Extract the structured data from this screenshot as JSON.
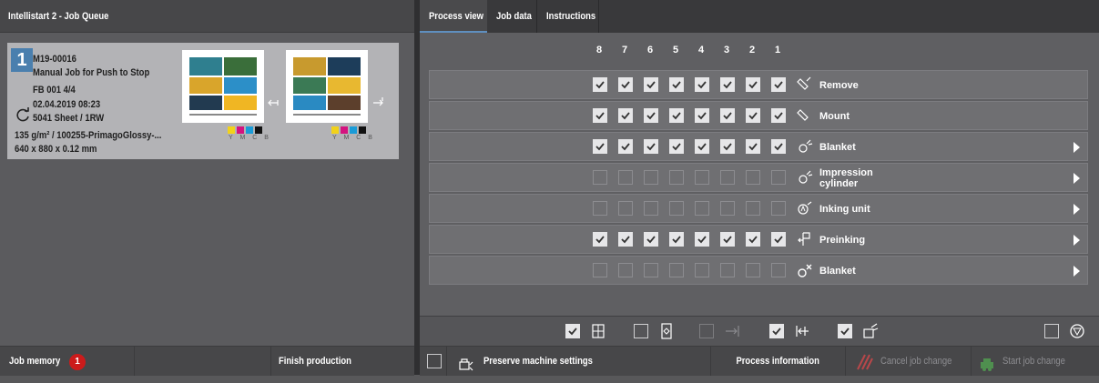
{
  "left_panel": {
    "title": "Intellistart 2 - Job Queue",
    "job": {
      "number": "1",
      "id": "M19-00016",
      "name": "Manual Job for Push to Stop",
      "form": "FB 001  4/4",
      "date": "02.04.2019 08:23",
      "sheets": "5041 Sheet / 1RW",
      "paper": "135 g/m² / 100255-PrimagoGlossy-...",
      "format": "640 x 880 x 0.12 mm",
      "ink_labels": "Y M C B",
      "ink_colors": [
        "#f2d21a",
        "#d4137f",
        "#1a9bd7",
        "#111111"
      ]
    },
    "bottom": {
      "job_memory": "Job memory",
      "job_memory_count": "1",
      "finish_production": "Finish production"
    }
  },
  "right_panel": {
    "tabs": [
      {
        "label": "Process view",
        "active": true
      },
      {
        "label": "Job data",
        "active": false
      },
      {
        "label": "Instructions",
        "active": false
      }
    ],
    "units": [
      "8",
      "7",
      "6",
      "5",
      "4",
      "3",
      "2",
      "1"
    ],
    "rows": [
      {
        "label": "Remove",
        "checked": [
          true,
          true,
          true,
          true,
          true,
          true,
          true,
          true
        ],
        "icon": "plate-remove-icon",
        "has_arrow": false
      },
      {
        "label": "Mount",
        "checked": [
          true,
          true,
          true,
          true,
          true,
          true,
          true,
          true
        ],
        "icon": "plate-mount-icon",
        "has_arrow": false
      },
      {
        "label": "Blanket",
        "checked": [
          true,
          true,
          true,
          true,
          true,
          true,
          true,
          true
        ],
        "icon": "blanket-wash-icon",
        "has_arrow": true
      },
      {
        "label": "Impression cylinder",
        "checked": [
          false,
          false,
          false,
          false,
          false,
          false,
          false,
          false
        ],
        "icon": "impression-cylinder-icon",
        "has_arrow": true
      },
      {
        "label": "Inking unit",
        "checked": [
          false,
          false,
          false,
          false,
          false,
          false,
          false,
          false
        ],
        "icon": "inking-unit-icon",
        "has_arrow": true
      },
      {
        "label": "Preinking",
        "checked": [
          true,
          true,
          true,
          true,
          true,
          true,
          true,
          true
        ],
        "icon": "preinking-icon",
        "has_arrow": true
      },
      {
        "label": "Blanket",
        "checked": [
          false,
          false,
          false,
          false,
          false,
          false,
          false,
          false
        ],
        "icon": "blanket-change-icon",
        "has_arrow": true
      }
    ],
    "icon_bar": [
      {
        "checked": true,
        "icon": "register-icon",
        "enabled": true
      },
      {
        "checked": false,
        "icon": "format-icon",
        "enabled": true
      },
      {
        "checked": false,
        "icon": "feeder-icon",
        "enabled": false
      },
      {
        "checked": true,
        "icon": "delivery-icon",
        "enabled": true
      },
      {
        "checked": true,
        "icon": "ink-preset-icon",
        "enabled": true
      },
      {
        "checked": false,
        "icon": "stop-icon",
        "enabled": true
      }
    ],
    "bottom": {
      "preserve": "Preserve machine settings",
      "process_info": "Process information",
      "cancel": "Cancel job change",
      "start": "Start job change"
    }
  }
}
